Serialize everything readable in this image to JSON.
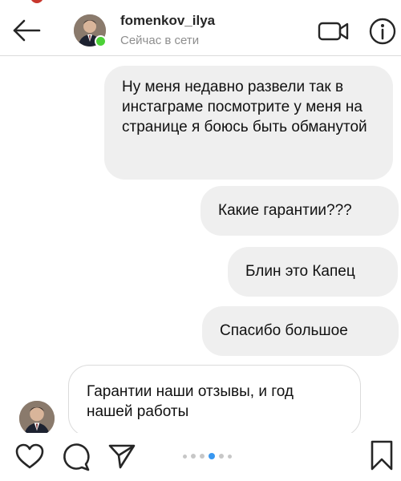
{
  "header": {
    "username": "fomenkov_ilya",
    "status": "Сейчас в сети",
    "back_icon": "arrow-left-icon",
    "video_icon": "video-camera-icon",
    "info_icon": "info-icon",
    "online_color": "#4cd137"
  },
  "messages": [
    {
      "sender": "me",
      "text": "Ну меня  недавно развели так в инстаграме посмотрите у меня  на странице я боюсь быть обманутой"
    },
    {
      "sender": "me",
      "text": "Какие гарантии???"
    },
    {
      "sender": "me",
      "text": "Блин это Капец"
    },
    {
      "sender": "me",
      "text": "Спасибо  большое"
    },
    {
      "sender": "them",
      "text": "Гарантии наши отзывы, и год нашей работы"
    }
  ],
  "bottom_bar": {
    "icons": [
      "heart-icon",
      "comment-icon",
      "share-icon",
      "bookmark-icon"
    ],
    "carousel_dots": 6,
    "active_dot": 3,
    "active_color": "#3897f0"
  },
  "colors": {
    "bubble_bg": "#efefef",
    "incoming_border": "#dbdbdb",
    "muted_text": "#8e8e8e"
  }
}
